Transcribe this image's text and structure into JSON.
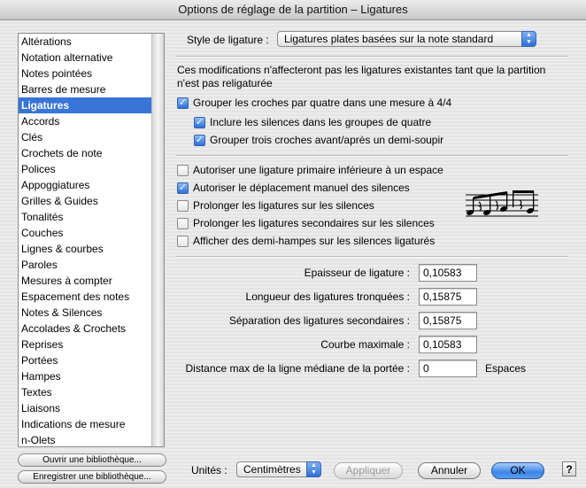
{
  "window": {
    "title": "Options de réglage de la partition – Ligatures"
  },
  "sidebar": {
    "items": [
      {
        "label": "Altérations",
        "selected": false
      },
      {
        "label": "Notation alternative",
        "selected": false
      },
      {
        "label": "Notes pointées",
        "selected": false
      },
      {
        "label": "Barres de mesure",
        "selected": false
      },
      {
        "label": "Ligatures",
        "selected": true
      },
      {
        "label": "Accords",
        "selected": false
      },
      {
        "label": "Clés",
        "selected": false
      },
      {
        "label": "Crochets de note",
        "selected": false
      },
      {
        "label": "Polices",
        "selected": false
      },
      {
        "label": "Appoggiatures",
        "selected": false
      },
      {
        "label": "Grilles & Guides",
        "selected": false
      },
      {
        "label": "Tonalités",
        "selected": false
      },
      {
        "label": "Couches",
        "selected": false
      },
      {
        "label": "Lignes & courbes",
        "selected": false
      },
      {
        "label": "Paroles",
        "selected": false
      },
      {
        "label": "Mesures à compter",
        "selected": false
      },
      {
        "label": "Espacement des notes",
        "selected": false
      },
      {
        "label": "Notes & Silences",
        "selected": false
      },
      {
        "label": "Accolades & Crochets",
        "selected": false
      },
      {
        "label": "Reprises",
        "selected": false
      },
      {
        "label": "Portées",
        "selected": false
      },
      {
        "label": "Hampes",
        "selected": false
      },
      {
        "label": "Textes",
        "selected": false
      },
      {
        "label": "Liaisons",
        "selected": false
      },
      {
        "label": "Indications de mesure",
        "selected": false
      },
      {
        "label": "n-Olets",
        "selected": false
      }
    ],
    "open_library_label": "Ouvrir une bibliothèque...",
    "save_library_label": "Enregistrer une bibliothèque..."
  },
  "style": {
    "label": "Style de ligature :",
    "value": "Ligatures plates basées sur la note standard"
  },
  "notice": "Ces modifications n'affecteront pas les ligatures existantes tant que la partition n'est pas religaturée",
  "group_options": {
    "main": {
      "label": "Grouper les croches par quatre dans une mesure à 4/4",
      "checked": true
    },
    "include_rests": {
      "label": "Inclure les silences dans les groupes de quatre",
      "checked": true
    },
    "group_three": {
      "label": "Grouper trois croches avant/après un demi-soupir",
      "checked": true
    }
  },
  "beam_options": {
    "primary_below": {
      "label": "Autoriser une ligature primaire inférieure à un espace",
      "checked": false
    },
    "manual_rests": {
      "label": "Autoriser le déplacement manuel des silences",
      "checked": true
    },
    "extend_over_rests": {
      "label": "Prolonger les ligatures sur les silences",
      "checked": false
    },
    "extend_secondary": {
      "label": "Prolonger les ligatures secondaires sur les silences",
      "checked": false
    },
    "half_stems": {
      "label": "Afficher des demi-hampes sur les silences ligaturés",
      "checked": false
    }
  },
  "fields": {
    "thickness": {
      "label": "Epaisseur de ligature :",
      "value": "0,10583"
    },
    "broken_length": {
      "label": "Longueur des ligatures tronquées :",
      "value": "0,15875"
    },
    "secondary_sep": {
      "label": "Séparation des ligatures secondaires :",
      "value": "0,15875"
    },
    "max_slope": {
      "label": "Courbe maximale :",
      "value": "0,10583"
    },
    "max_distance": {
      "label": "Distance max de la ligne médiane de la portée :",
      "value": "0",
      "unit": "Espaces"
    }
  },
  "footer": {
    "units_label": "Unités :",
    "units_value": "Centimètres",
    "apply_label": "Appliquer",
    "cancel_label": "Annuler",
    "ok_label": "OK",
    "help_label": "?"
  },
  "icons": {
    "popup_arrows": "updown-arrows-icon",
    "checkmark": "checkmark-icon",
    "preview": "beamed-notes-preview"
  },
  "colors": {
    "selection": "#3875d7",
    "default_button": "#3d86e8"
  }
}
